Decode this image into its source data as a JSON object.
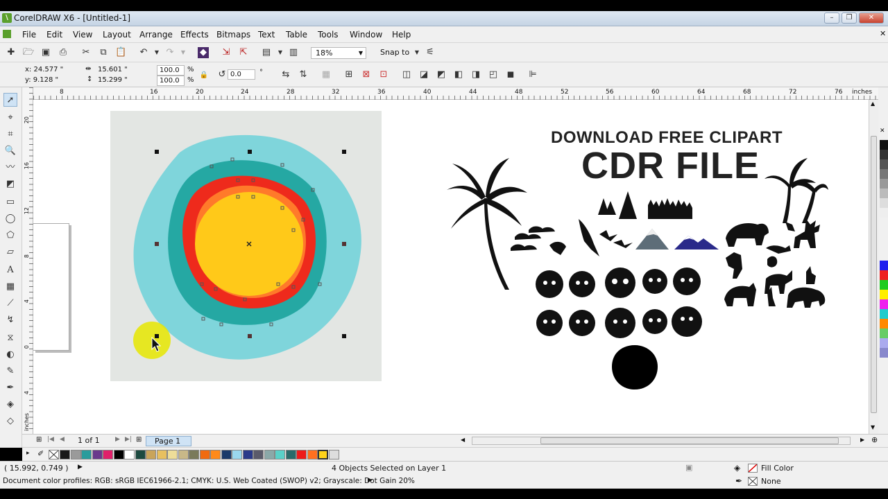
{
  "window": {
    "title": "CorelDRAW X6 - [Untitled-1]"
  },
  "menu": [
    "File",
    "Edit",
    "View",
    "Layout",
    "Arrange",
    "Effects",
    "Bitmaps",
    "Text",
    "Table",
    "Tools",
    "Window",
    "Help"
  ],
  "toolbar": {
    "zoom": "18%",
    "snap_to": "Snap to"
  },
  "props": {
    "x": "x: 24.577 \"",
    "y": "y: 9.128 \"",
    "width": "15.601 \"",
    "height": "15.299 \"",
    "scale_w": "100.0",
    "scale_h": "100.0",
    "percent": "%",
    "rotation": "0.0",
    "degree": "°"
  },
  "ruler": {
    "unit": "inches",
    "h_ticks": [
      "8",
      "16",
      "20",
      "24",
      "28",
      "32",
      "36",
      "40",
      "44",
      "48",
      "52",
      "56",
      "60",
      "64",
      "68",
      "72",
      "76"
    ],
    "v_ticks": [
      "20",
      "16",
      "12",
      "8",
      "4",
      "0",
      "4"
    ]
  },
  "canvas": {
    "headline1": "DOWNLOAD FREE CLIPART",
    "headline2": "CDR FILE"
  },
  "pagebar": {
    "count": "1 of 1",
    "page_tab": "Page 1"
  },
  "palette": [
    "#1a1a1a",
    "#9a9a9a",
    "#2a9c9c",
    "#6a3a8c",
    "#e0206a",
    "#000000",
    "#ffffff",
    "#1c4a40",
    "#c9a45a",
    "#e8c060",
    "#eedd99",
    "#c8b888",
    "#7a7a5a",
    "#f06a10",
    "#ff8a1a",
    "#1a3a6a",
    "#9ad8ee",
    "#2a3a8a",
    "#5a5a6a",
    "#8aa8a8",
    "#5ad0c8",
    "#2a6a6a",
    "#ee1a1a",
    "#ff7020",
    "#ffd21a",
    "#dddddd"
  ],
  "status": {
    "coords": "( 15.992, 0.749 )",
    "selection": "4 Objects Selected on Layer 1",
    "fill_label": "Fill Color",
    "outline_label": "None",
    "color_profiles": "Document color profiles: RGB: sRGB IEC61966-2.1; CMYK: U.S. Web Coated (SWOP) v2; Grayscale: Dot Gain 20%"
  },
  "colors": {
    "ring_outer": "#7fd5db",
    "ring_teal": "#25a8a3",
    "ring_red": "#ee2a1c",
    "ring_orange": "#ff7a2a",
    "sun": "#ffc919",
    "artboard": "#e3e6e3"
  }
}
